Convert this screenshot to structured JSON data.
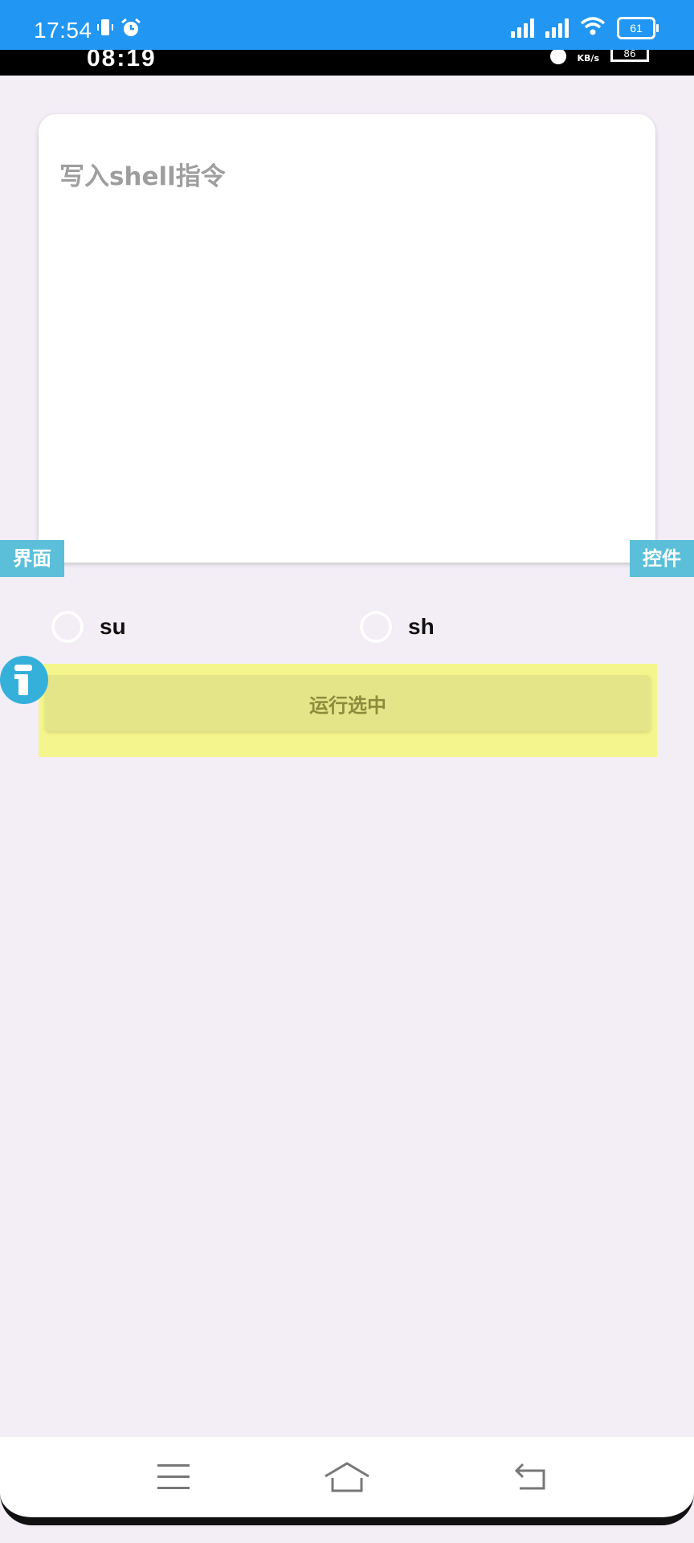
{
  "status_bar": {
    "time": "17:54",
    "battery": "61",
    "icons": [
      "vibrate-icon",
      "alarm-icon",
      "signal-icon",
      "signal-icon",
      "wifi-icon",
      "battery-icon"
    ]
  },
  "inner_status_bar": {
    "time": "08:19",
    "speed_unit": "KB/s",
    "battery": "86"
  },
  "command_input": {
    "placeholder": "写入shell指令",
    "value": ""
  },
  "side_tabs": {
    "left": "界面",
    "right": "控件"
  },
  "shell_options": [
    {
      "label": "su",
      "selected": false
    },
    {
      "label": "sh",
      "selected": false
    }
  ],
  "run_button": {
    "label": "运行选中"
  },
  "navigation": {
    "icons": [
      "menu-icon",
      "home-icon",
      "back-icon"
    ]
  },
  "colors": {
    "status_bar": "#2196f3",
    "background": "#f3edf6",
    "side_tab": "#5bbfd9",
    "highlight": "#f5f58d",
    "button": "#e4e489"
  }
}
